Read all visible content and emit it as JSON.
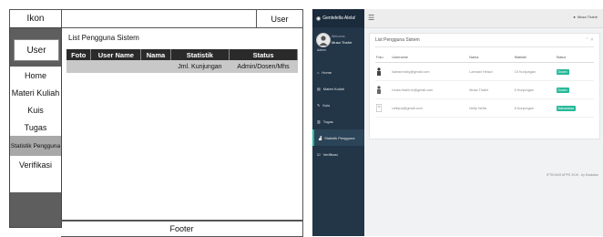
{
  "wireframe": {
    "ikon": "Ikon",
    "top_user": "User",
    "sidebar_user": "User",
    "menu": [
      "Home",
      "Materi Kuliah",
      "Kuis",
      "Tugas"
    ],
    "menu_active": "Statistik Pengguna",
    "menu_after": "Verifikasi",
    "section_title": "List Pengguna Sistem",
    "table_headers": [
      "Foto",
      "User Name",
      "Nama",
      "Statistik",
      "Status"
    ],
    "table_row": [
      "",
      "",
      "",
      "Jml. Kunjungan",
      "Admin/Dosen/Mhs"
    ],
    "footer": "Footer"
  },
  "app": {
    "brand": "Gentelella Alela!",
    "welcome": "Welcome,",
    "username": "Musa Thahir",
    "role": "Admin",
    "top_user": "Musa Thahir",
    "nav": [
      "Home",
      "Materi Kuliah",
      "Kuis",
      "Tugas",
      "Statistik Pengguna",
      "Verifikasi"
    ],
    "active_nav_index": 4,
    "panel_title": "List Pengguna Sistem",
    "panel_tools": "⌃ ✕",
    "table_headers": [
      "Foto",
      "Username",
      "Nama",
      "Statistik",
      "Status"
    ],
    "rows": [
      {
        "username": "ilamamrizky@gmail.com",
        "nama": "Lamrani Helaci",
        "statistik": "15 Kunjungan",
        "status": "Dosen",
        "status_color": "#26b99a"
      },
      {
        "username": "musa.thahir.m@gmail.com",
        "nama": "Musa Thahir",
        "statistik": "6 Kunjungan",
        "status": "Dosen",
        "status_color": "#26b99a"
      },
      {
        "username": "nelfyna@gmail.com",
        "nama": "Nelfy Nelfa",
        "statistik": "8 Kunjungan",
        "status": "Mahasiswa",
        "status_color": "#26b99a"
      }
    ],
    "footer": "IFTIKHAR APPS 2019 - by Mustafaz"
  },
  "colors": {
    "wf_sidebar": "#5e5e5e",
    "app_sidebar": "#223648",
    "app_accent": "#1abb9c"
  }
}
